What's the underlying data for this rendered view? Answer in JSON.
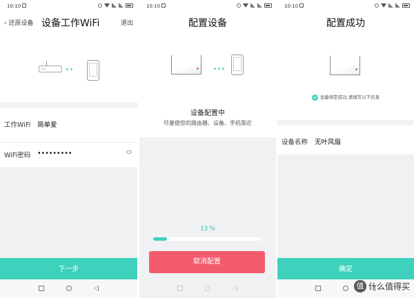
{
  "status": {
    "time": "10:10"
  },
  "screen1": {
    "back_label": "‹ 还原设备",
    "title": "设备工作WiFi",
    "exit_label": "退出",
    "wifi_label": "工作WiFi",
    "wifi_value": "简单爱",
    "password_label": "WiFi密码",
    "password_value": "•••••••••",
    "next_button": "下一步"
  },
  "screen2": {
    "title": "配置设备",
    "status_heading": "设备配置中",
    "status_hint": "尽量使您的路由器、设备、手机靠近",
    "progress_text": "13 %",
    "progress_value": 0.13,
    "cancel_button": "取消配置"
  },
  "screen3": {
    "title": "配置成功",
    "success_message": "设备绑定成功,请填写以下信息",
    "device_name_label": "设备名称",
    "device_name_value": "无叶风扇",
    "confirm_button": "确定"
  },
  "watermark": {
    "badge": "值",
    "text": "什么值得买"
  },
  "colors": {
    "accent": "#3ed1bb",
    "danger": "#f25b6b",
    "background_gray": "#f0f1f3"
  }
}
